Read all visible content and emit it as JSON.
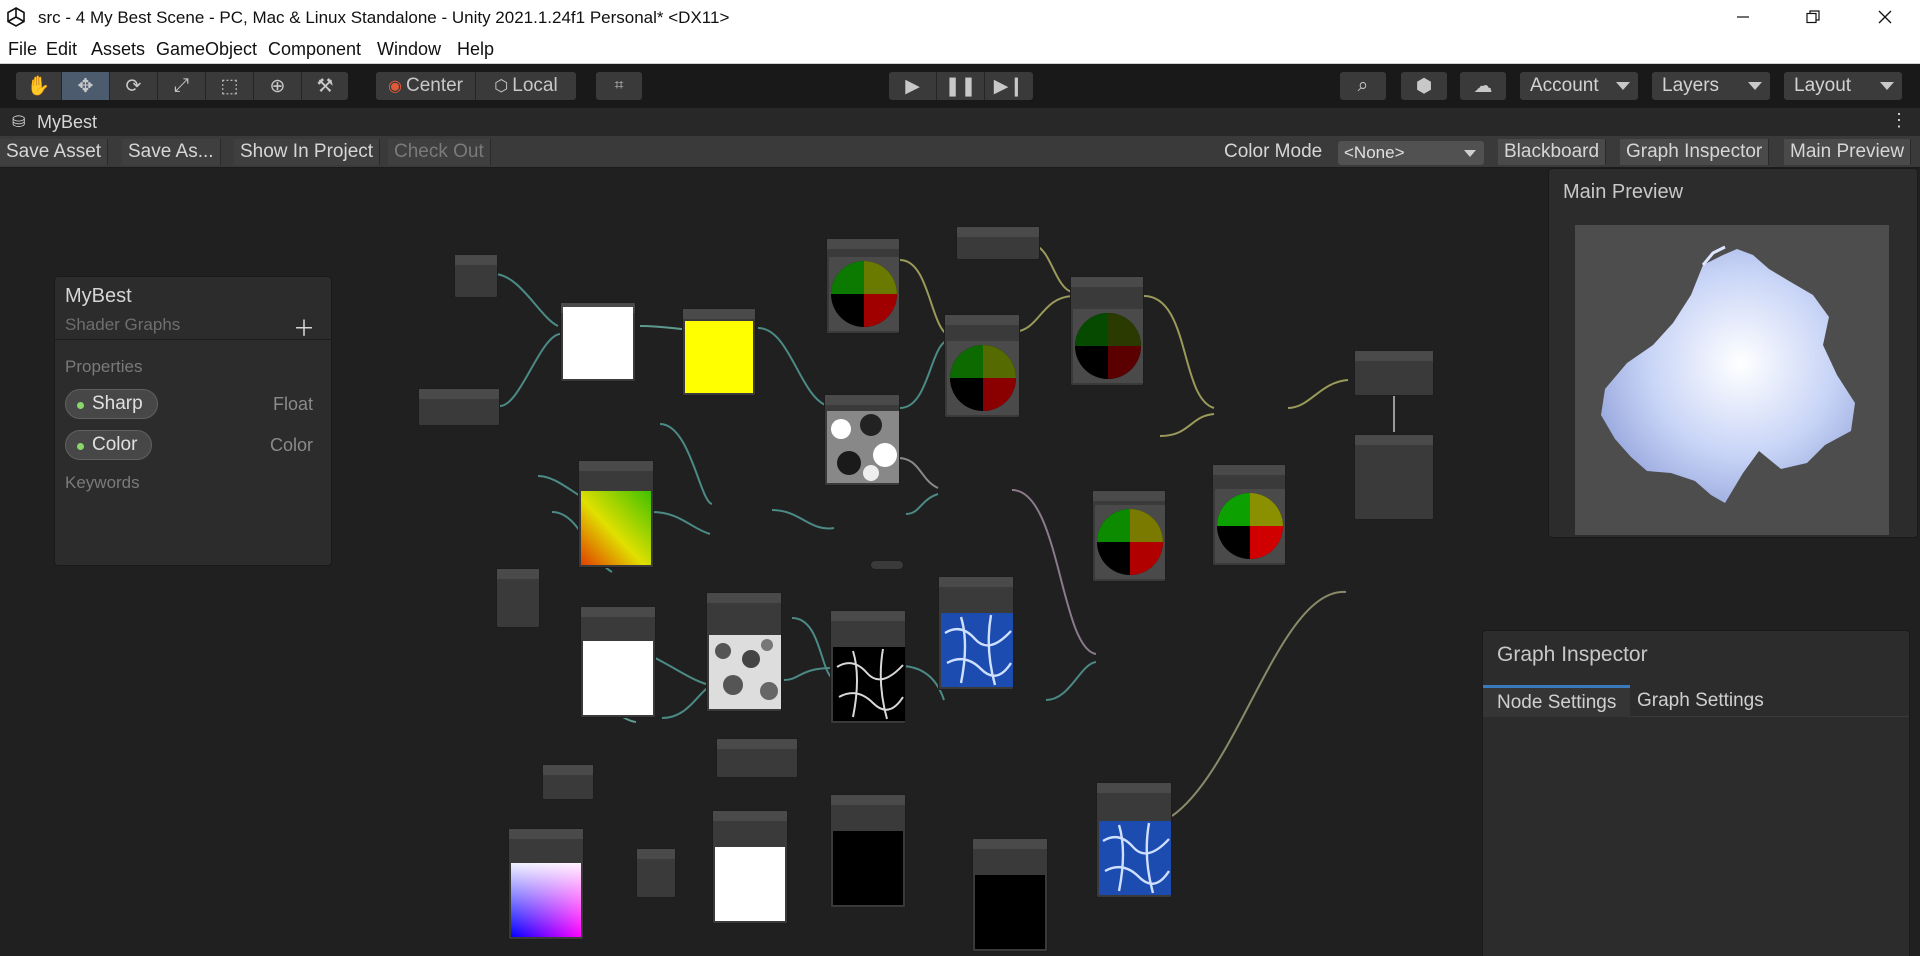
{
  "window": {
    "title": "src - 4 My Best Scene - PC, Mac & Linux Standalone - Unity 2021.1.24f1 Personal* <DX11>",
    "min_icon": "minimize-icon",
    "max_icon": "restore-icon",
    "close_icon": "close-icon"
  },
  "menu": [
    "File",
    "Edit",
    "Assets",
    "GameObject",
    "Component",
    "Window",
    "Help"
  ],
  "toolbar": {
    "pivot_label": "Center",
    "space_label": "Local",
    "account_label": "Account",
    "layers_label": "Layers",
    "layout_label": "Layout"
  },
  "tab": {
    "title": "MyBest"
  },
  "graph_toolbar": {
    "save_asset": "Save Asset",
    "save_as": "Save As...",
    "show_in_project": "Show In Project",
    "check_out": "Check Out",
    "color_mode_label": "Color Mode",
    "color_mode_value": "<None>",
    "blackboard": "Blackboard",
    "graph_inspector": "Graph Inspector",
    "main_preview": "Main Preview"
  },
  "blackboard": {
    "title": "MyBest",
    "subtitle": "Shader Graphs",
    "properties_label": "Properties",
    "keywords_label": "Keywords",
    "properties": [
      {
        "name": "Sharp",
        "type": "Float"
      },
      {
        "name": "Color",
        "type": "Color"
      }
    ]
  },
  "main_preview": {
    "title": "Main Preview"
  },
  "graph_inspector": {
    "title": "Graph Inspector",
    "tabs": [
      "Node Settings",
      "Graph Settings"
    ]
  },
  "colors": {
    "accent_blue": "#3a79bb",
    "port_green": "#9bd27b",
    "yellow_preview": "#ffff00"
  }
}
